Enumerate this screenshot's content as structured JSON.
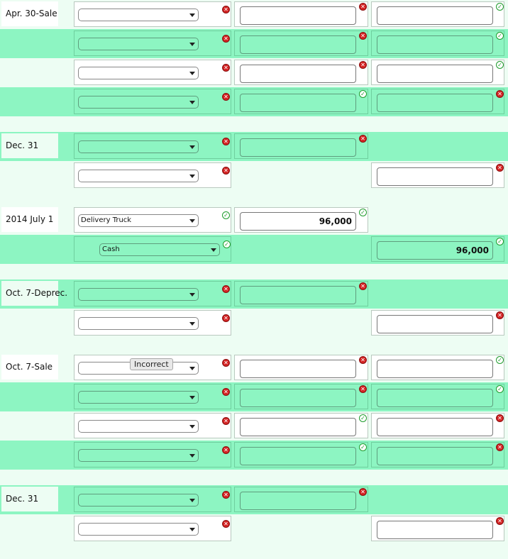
{
  "tooltip": "Incorrect",
  "rows": [
    {
      "type": "light",
      "date": "Apr. 30-Sale",
      "account": "",
      "debit": "",
      "credit": "",
      "mark_account": "x",
      "mark_debit": "x",
      "mark_credit": "ok",
      "indent": false
    },
    {
      "type": "green",
      "date": "",
      "account": "",
      "debit": "",
      "credit": "",
      "mark_account": "x",
      "mark_debit": "x",
      "mark_credit": "ok",
      "indent": false
    },
    {
      "type": "light",
      "date": "",
      "account": "",
      "debit": "",
      "credit": "",
      "mark_account": "x",
      "mark_debit": "x",
      "mark_credit": "ok",
      "indent": false
    },
    {
      "type": "green",
      "date": "",
      "account": "",
      "debit": "",
      "credit": "",
      "mark_account": "x",
      "mark_debit": "ok",
      "mark_credit": "x",
      "indent": false
    },
    {
      "type": "spacer"
    },
    {
      "type": "green",
      "date": "Dec. 31",
      "account": "",
      "debit": "",
      "credit": null,
      "mark_account": "x",
      "mark_debit": "x",
      "mark_credit": null,
      "indent": false
    },
    {
      "type": "light",
      "date": "",
      "account": "",
      "debit": null,
      "credit": "",
      "mark_account": "x",
      "mark_debit": null,
      "mark_credit": "x",
      "indent": false
    },
    {
      "type": "spacer"
    },
    {
      "type": "light",
      "date": "2014 July 1",
      "account": "Delivery Truck",
      "debit": "96,000",
      "credit": null,
      "mark_account": "ok",
      "mark_debit": "ok",
      "mark_credit": null,
      "indent": false
    },
    {
      "type": "green",
      "date": "",
      "account": "Cash",
      "debit": null,
      "credit": "96,000",
      "mark_account": "ok",
      "mark_debit": null,
      "mark_credit": "ok",
      "indent": true
    },
    {
      "type": "spacer"
    },
    {
      "type": "green",
      "date": "Oct. 7-Deprec.",
      "account": "",
      "debit": "",
      "credit": null,
      "mark_account": "x",
      "mark_debit": "x",
      "mark_credit": null,
      "indent": false
    },
    {
      "type": "light",
      "date": "",
      "account": "",
      "debit": null,
      "credit": "",
      "mark_account": "x",
      "mark_debit": null,
      "mark_credit": "x",
      "indent": false
    },
    {
      "type": "spacer"
    },
    {
      "type": "light",
      "date": "Oct. 7-Sale",
      "account": "",
      "debit": "",
      "credit": "",
      "mark_account": "x",
      "mark_debit": "x",
      "mark_credit": "ok",
      "indent": false
    },
    {
      "type": "green",
      "date": "",
      "account": "",
      "debit": "",
      "credit": "",
      "mark_account": "x",
      "mark_debit": "x",
      "mark_credit": "ok",
      "indent": false
    },
    {
      "type": "light",
      "date": "",
      "account": "",
      "debit": "",
      "credit": "",
      "mark_account": "x",
      "mark_debit": "ok",
      "mark_credit": "x",
      "indent": false
    },
    {
      "type": "green",
      "date": "",
      "account": "",
      "debit": "",
      "credit": "",
      "mark_account": "x",
      "mark_debit": "ok",
      "mark_credit": "x",
      "indent": false
    },
    {
      "type": "spacer"
    },
    {
      "type": "green",
      "date": "Dec. 31",
      "account": "",
      "debit": "",
      "credit": null,
      "mark_account": "x",
      "mark_debit": "x",
      "mark_credit": null,
      "indent": false
    },
    {
      "type": "light",
      "date": "",
      "account": "",
      "debit": null,
      "credit": "",
      "mark_account": "x",
      "mark_debit": null,
      "mark_credit": "x",
      "indent": false
    },
    {
      "type": "spacer"
    }
  ]
}
